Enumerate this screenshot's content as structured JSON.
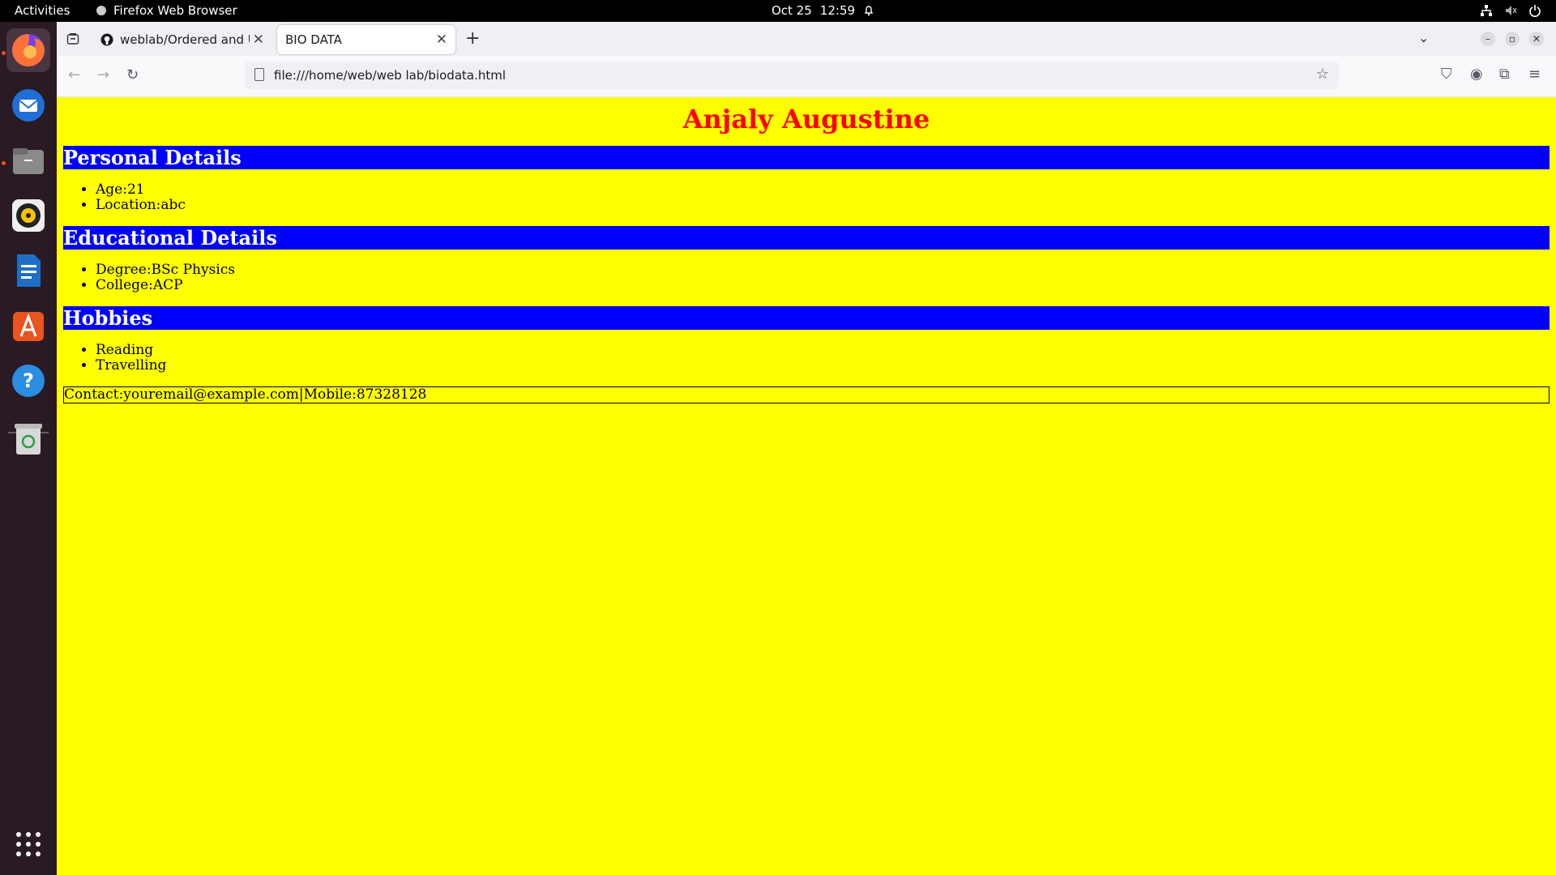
{
  "topbar": {
    "activities": "Activities",
    "app_name": "Firefox Web Browser",
    "date": "Oct 25",
    "time": "12:59"
  },
  "browser": {
    "tabs": [
      {
        "title": "weblab/Ordered and Unordered",
        "active": false
      },
      {
        "title": "BIO DATA",
        "active": true
      }
    ],
    "url": "file:///home/web/web lab/biodata.html"
  },
  "page": {
    "name": "Anjaly Augustine",
    "sections": [
      {
        "heading": "Personal Details",
        "items": [
          "Age:21",
          "Location:abc"
        ]
      },
      {
        "heading": "Educational Details",
        "items": [
          "Degree:BSc Physics",
          "College:ACP"
        ]
      },
      {
        "heading": "Hobbies",
        "items": [
          "Reading",
          "Travelling"
        ]
      }
    ],
    "contact": "Contact:youremail@example.com|Mobile:87328128"
  },
  "colors": {
    "page_background": "#ffff00",
    "name_color": "#ff0000",
    "section_background": "#0000ff",
    "section_text": "#ffffff"
  }
}
